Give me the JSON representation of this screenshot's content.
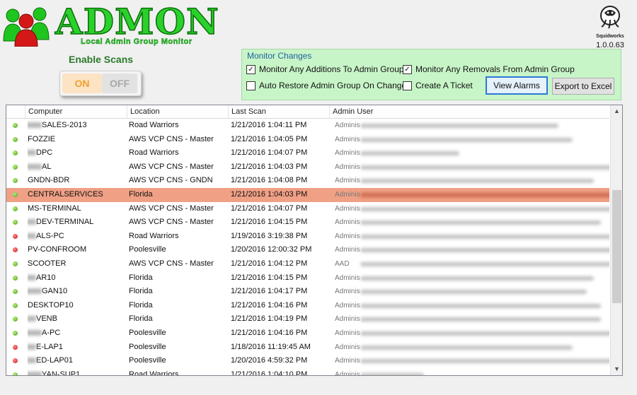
{
  "app": {
    "title": "ADMON",
    "subtitle": "Local Admin Group Monitor",
    "vendor": "Squidworks",
    "version": "1.0.0.63"
  },
  "scan": {
    "label": "Enable Scans",
    "on_label": "ON",
    "off_label": "OFF",
    "state": "ON"
  },
  "monitor": {
    "title": "Monitor Changes",
    "additions": {
      "label": "Monitor Any  Additions To Admin Groups",
      "checked": true
    },
    "removals": {
      "label": "Monitor Any Removals From Admin Group",
      "checked": true
    },
    "auto_restore": {
      "label": "Auto Restore Admin Group On Change",
      "checked": false
    },
    "ticket": {
      "label": "Create A Ticket",
      "checked": false
    },
    "view_alarms": "View Alarms",
    "export": "Export to Excel"
  },
  "table": {
    "columns": [
      "Computer",
      "Location",
      "Last Scan",
      "Admin User"
    ],
    "rows": [
      {
        "status": "green",
        "computer": "SALES-2013",
        "location": "Road Warriors",
        "scan": "1/21/2016 1:04:11 PM",
        "admin": "Adminis",
        "blur_width": 280
      },
      {
        "status": "green",
        "computer": "FOZZIE",
        "location": "AWS VCP CNS - Master",
        "scan": "1/21/2016 1:04:05 PM",
        "admin": "Adminis",
        "blur_width": 300
      },
      {
        "status": "green",
        "computer": "DPC",
        "location": "Road Warriors",
        "scan": "1/21/2016 1:04:07 PM",
        "admin": "Adminis",
        "blur_width": 140
      },
      {
        "status": "green",
        "computer": "AL",
        "location": "AWS VCP CNS - Master",
        "scan": "1/21/2016 1:04:03 PM",
        "admin": "Adminis",
        "blur_width": 370
      },
      {
        "status": "green",
        "computer": "GNDN-BDR",
        "location": "AWS VCP CNS - GNDN",
        "scan": "1/21/2016 1:04:08 PM",
        "admin": "Adminis",
        "blur_width": 330
      },
      {
        "status": "green",
        "computer": "CENTRALSERVICES",
        "location": "Florida",
        "scan": "1/21/2016 1:04:03 PM",
        "admin": "Adminis",
        "blur_width": 380,
        "selected": true
      },
      {
        "status": "green",
        "computer": "MS-TERMINAL",
        "location": "AWS VCP CNS - Master",
        "scan": "1/21/2016 1:04:07 PM",
        "admin": "Adminis",
        "blur_width": 360
      },
      {
        "status": "green",
        "computer": "DEV-TERMINAL",
        "location": "AWS VCP CNS - Master",
        "scan": "1/21/2016 1:04:15 PM",
        "admin": "Adminis",
        "blur_width": 340
      },
      {
        "status": "red",
        "computer": "ALS-PC",
        "location": "Road Warriors",
        "scan": "1/19/2016 3:19:38 PM",
        "admin": "Adminis",
        "blur_width": 380,
        "tail": "ALS..."
      },
      {
        "status": "red",
        "computer": "PV-CONFROOM",
        "location": "Poolesville",
        "scan": "1/20/2016 12:00:32 PM",
        "admin": "Adminis",
        "blur_width": 370
      },
      {
        "status": "green",
        "computer": "SCOOTER",
        "location": "AWS VCP CNS - Master",
        "scan": "1/21/2016 1:04:12 PM",
        "admin": "AAD",
        "blur_width": 360
      },
      {
        "status": "green",
        "computer": "AR10",
        "location": "Florida",
        "scan": "1/21/2016 1:04:15 PM",
        "admin": "Adminis",
        "blur_width": 330
      },
      {
        "status": "green",
        "computer": "GAN10",
        "location": "Florida",
        "scan": "1/21/2016 1:04:17 PM",
        "admin": "Adminis",
        "blur_width": 320
      },
      {
        "status": "green",
        "computer": "DESKTOP10",
        "location": "Florida",
        "scan": "1/21/2016 1:04:16 PM",
        "admin": "Adminis",
        "blur_width": 340
      },
      {
        "status": "green",
        "computer": "VENB",
        "location": "Florida",
        "scan": "1/21/2016 1:04:19 PM",
        "admin": "Adminis",
        "blur_width": 340
      },
      {
        "status": "green",
        "computer": "A-PC",
        "location": "Poolesville",
        "scan": "1/21/2016 1:04:16 PM",
        "admin": "Adminis",
        "blur_width": 380,
        "tail": "NE..."
      },
      {
        "status": "red",
        "computer": "E-LAP1",
        "location": "Poolesville",
        "scan": "1/18/2016 11:19:45 AM",
        "admin": "Adminis",
        "blur_width": 300
      },
      {
        "status": "red",
        "computer": "ED-LAP01",
        "location": "Poolesville",
        "scan": "1/20/2016 4:59:32 PM",
        "admin": "Adminis",
        "blur_width": 370
      },
      {
        "status": "green",
        "computer": "YAN-SUP1",
        "location": "Road Warriors",
        "scan": "1/21/2016 1:04:10 PM",
        "admin": "Adminis",
        "blur_width": 90
      }
    ]
  }
}
